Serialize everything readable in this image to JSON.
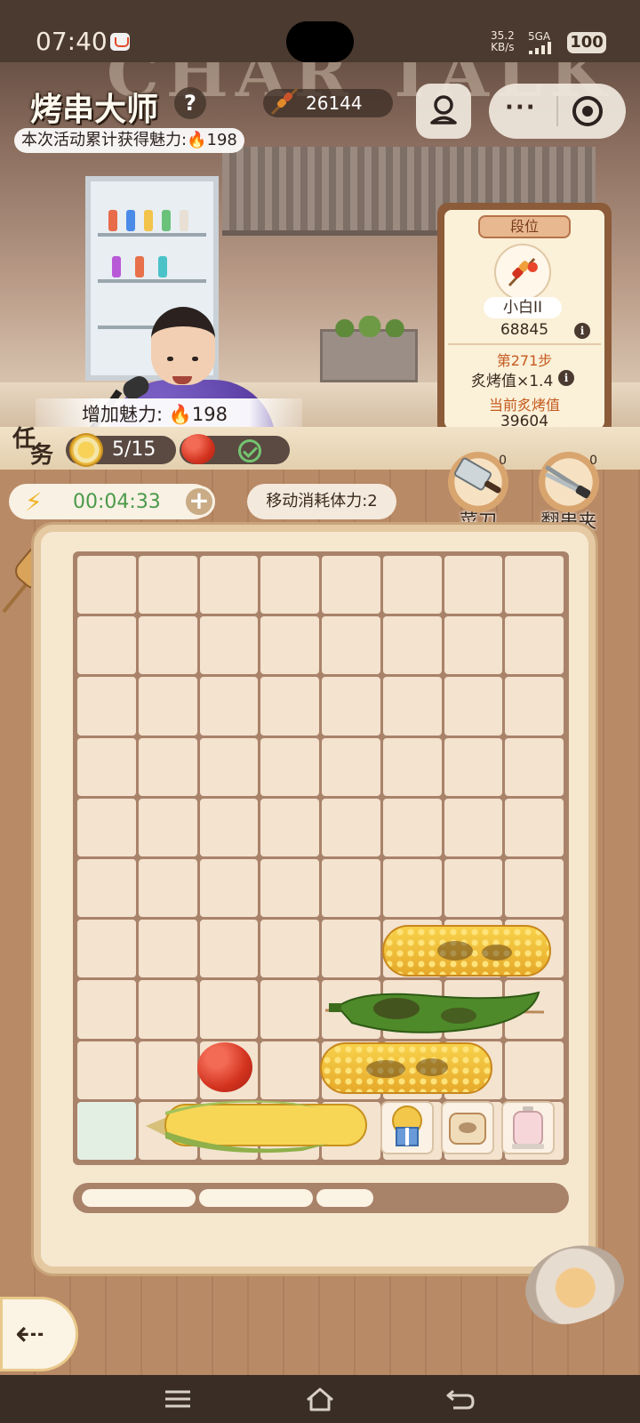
{
  "status_bar": {
    "time": "07:40",
    "speed_value": "35.2",
    "speed_unit": "KB/s",
    "network": "5GA",
    "battery": "100"
  },
  "header": {
    "title": "烤串大师",
    "help_icon": "question-icon",
    "skewer_count": "26144",
    "charm_total_label": "本次活动累计获得魅力:",
    "charm_total_value": "198"
  },
  "scene": {
    "sign_text": "CHAR TALK",
    "charm_added_label": "增加魅力:",
    "charm_added_value": "198"
  },
  "rank_card": {
    "tab_label": "段位",
    "rank_name": "小白II",
    "rank_score": "68845",
    "step_label": "第271步",
    "multiplier_label": "炙烤值×1.4",
    "current_label": "当前炙烤值",
    "current_value": "39604"
  },
  "task": {
    "label_1": "任",
    "label_2": "务",
    "progress": "5/15"
  },
  "energy": {
    "timer": "00:04:33",
    "plus": "+"
  },
  "move_cost": "移动消耗体力:2",
  "tools": [
    {
      "label": "菜刀",
      "count": "0",
      "icon": "cleaver-icon"
    },
    {
      "label": "翻串夹",
      "count": "0",
      "icon": "tongs-icon"
    }
  ],
  "board": {
    "rows": 10,
    "cols": 8,
    "pieces": [
      {
        "name": "grilled-corn",
        "row": 7,
        "col": 6,
        "span": 3
      },
      {
        "name": "grilled-green-pepper",
        "row": 8,
        "col": 5,
        "span": 4
      },
      {
        "name": "tomato",
        "row": 9,
        "col": 3,
        "span": 1
      },
      {
        "name": "grilled-corn",
        "row": 9,
        "col": 5,
        "span": 3
      },
      {
        "name": "raw-corn",
        "row": 10,
        "col": 2,
        "span": 4
      },
      {
        "name": "corn-gift-box",
        "row": 10,
        "col": 6,
        "span": 1
      },
      {
        "name": "toasted-bun",
        "row": 10,
        "col": 7,
        "span": 1
      },
      {
        "name": "seasoning-jar",
        "row": 10,
        "col": 8,
        "span": 1
      }
    ]
  },
  "colors": {
    "fire": "#e2522a",
    "timer_green": "#4a9a4a",
    "rank_highlight": "#c45a1e"
  }
}
